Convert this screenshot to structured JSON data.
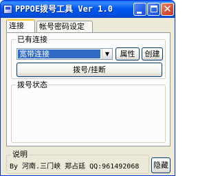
{
  "window": {
    "title": "PPPOE拨号工具 Ver 1.0",
    "minimize_icon": "minimize-icon",
    "maximize_icon": "maximize-icon",
    "close_icon": "close-icon",
    "close_glyph": "✕"
  },
  "tabs": [
    {
      "label": "连接",
      "active": true
    },
    {
      "label": "帐号密码设定",
      "active": false
    }
  ],
  "connections": {
    "group_title": "已有连接",
    "selected": "宽带连接",
    "dropdown_glyph": "▼",
    "properties_label": "属性",
    "create_label": "创建",
    "dial_label": "拨号/挂断"
  },
  "status": {
    "group_title": "拨号状态"
  },
  "description": {
    "title": "说明",
    "text": "By 河南.三门峡 郑占廷 QQ:961492068"
  },
  "hide_label": "隐藏",
  "colors": {
    "titlebar": "#0058ee",
    "window_bg": "#ece9d8",
    "selection": "#316ac5"
  }
}
